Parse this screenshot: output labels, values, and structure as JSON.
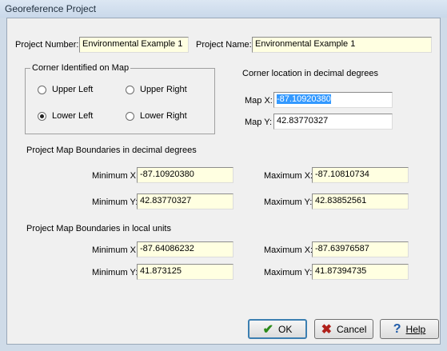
{
  "window": {
    "title": "Georeference Project"
  },
  "project": {
    "number_label": "Project Number:",
    "number_value": "Environmental Example 1",
    "name_label": "Project Name:",
    "name_value": "Environmental Example 1"
  },
  "corner": {
    "group_label": "Corner Identified on Map",
    "options": [
      "Upper Left",
      "Upper Right",
      "Lower Left",
      "Lower Right"
    ],
    "selected": "Lower Left",
    "location_label": "Corner location in decimal degrees",
    "map_x_label": "Map X:",
    "map_x_value": "-87.10920380",
    "map_y_label": "Map Y:",
    "map_y_value": "42.83770327"
  },
  "decimal_bounds": {
    "header": "Project Map Boundaries in decimal degrees",
    "min_x_label": "Minimum X:",
    "min_x": "-87.10920380",
    "max_x_label": "Maximum X:",
    "max_x": "-87.10810734",
    "min_y_label": "Minimum Y:",
    "min_y": "42.83770327",
    "max_y_label": "Maximum Y:",
    "max_y": "42.83852561"
  },
  "local_bounds": {
    "header": "Project Map Boundaries in local units",
    "min_x_label": "Minimum X:",
    "min_x": "-87.64086232",
    "max_x_label": "Maximum X:",
    "max_x": "-87.63976587",
    "min_y_label": "Minimum Y:",
    "min_y": "41.873125",
    "max_y_label": "Maximum Y:",
    "max_y": "41.87394735"
  },
  "buttons": {
    "ok": "OK",
    "cancel": "Cancel",
    "help": "Help"
  },
  "colors": {
    "field_bg": "#ffffe1",
    "selection": "#3399ff",
    "ok_icon": "#2a8a1a",
    "cancel_icon": "#b0201a",
    "help_icon": "#1e5aa8"
  }
}
